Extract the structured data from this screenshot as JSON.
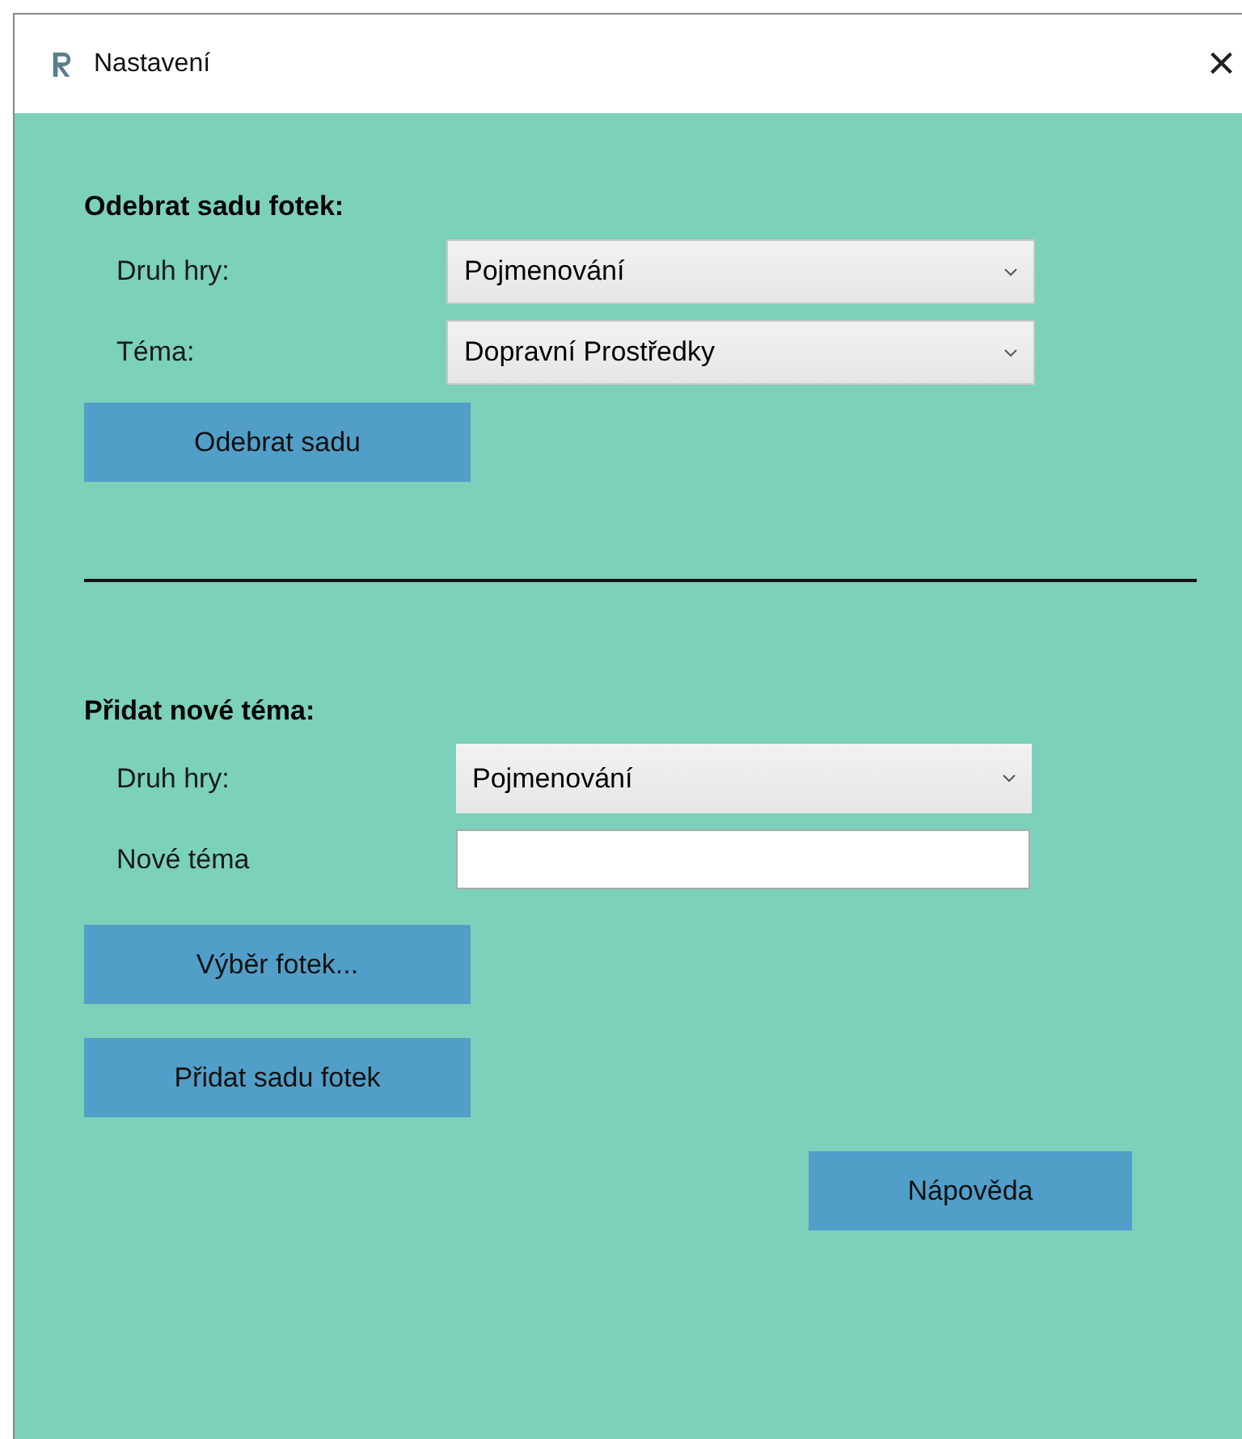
{
  "window": {
    "title": "Nastavení",
    "close": "×"
  },
  "remove_section": {
    "heading": "Odebrat sadu fotek:",
    "fields": [
      {
        "label": "Druh hry:",
        "kind": "dropdown",
        "value": "Pojmenování"
      },
      {
        "label": "Téma:",
        "kind": "dropdown",
        "value": "Dopravní Prostředky"
      }
    ],
    "buttons": [
      "Odebrat sadu"
    ]
  },
  "add_section": {
    "heading": "Přidat nové téma:",
    "fields": [
      {
        "label": "Druh hry:",
        "kind": "dropdown",
        "value": "Pojmenování"
      },
      {
        "label": "Nové téma",
        "kind": "text"
      }
    ],
    "buttons": [
      "Výběr fotek...",
      "Přidat sadu fotek"
    ]
  },
  "help_button": "Nápověda"
}
